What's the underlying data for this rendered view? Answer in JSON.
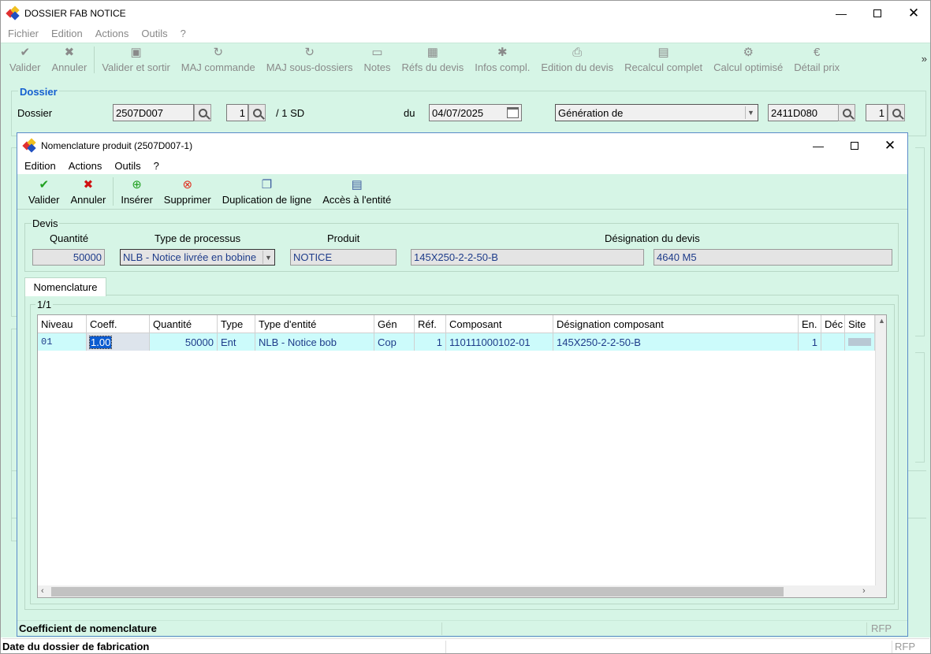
{
  "main": {
    "title": "DOSSIER FAB NOTICE",
    "menu": [
      "Fichier",
      "Edition",
      "Actions",
      "Outils",
      "?"
    ],
    "toolbar": {
      "valider": "Valider",
      "annuler": "Annuler",
      "valider_sortir": "Valider et sortir",
      "maj_commande": "MAJ commande",
      "maj_sous_dossiers": "MAJ sous-dossiers",
      "notes": "Notes",
      "refs_devis": "Réfs du devis",
      "infos": "Infos compl.",
      "edition_devis": "Edition du devis",
      "recalcul": "Recalcul complet",
      "calcul": "Calcul optimisé",
      "detail": "Détail prix",
      "more": "»"
    },
    "dossier_group": "Dossier",
    "dossier_label": "Dossier",
    "dossier_value": "2507D007",
    "sd_value": "1",
    "sd_total": "/ 1 SD",
    "du_label": "du",
    "date_value": "04/07/2025",
    "generation_value": "Génération de",
    "ref_value": "2411D080",
    "ref_num": "1",
    "status_bottom": "Date du dossier de fabrication",
    "status_rfp": "RFP"
  },
  "modal": {
    "title": "Nomenclature produit (2507D007-1)",
    "menu": [
      "Edition",
      "Actions",
      "Outils",
      "?"
    ],
    "toolbar": {
      "valider": "Valider",
      "annuler": "Annuler",
      "inserer": "Insérer",
      "supprimer": "Supprimer",
      "duplication": "Duplication de ligne",
      "acces": "Accès à l'entité"
    },
    "devis_group": "Devis",
    "quantite_label": "Quantité",
    "type_processus_label": "Type de processus",
    "produit_label": "Produit",
    "designation_label": "Désignation du devis",
    "quantite_value": "50000",
    "type_processus_value": "NLB - Notice livrée en bobine",
    "produit_value": "NOTICE",
    "designation_value_1": "145X250-2-2-50-B",
    "designation_value_2": "4640 M5",
    "tab_label": "Nomenclature",
    "page_info": "1/1",
    "columns": [
      "Niveau",
      "Coeff.",
      "Quantité",
      "Type",
      "Type d'entité",
      "Gén",
      "Réf.",
      "Composant",
      "Désignation composant",
      "En.",
      "Déc",
      "Site"
    ],
    "rows": [
      {
        "niveau": "01",
        "coeff": "1.00",
        "quantite": "50000",
        "type": "Ent",
        "type_entite": "NLB - Notice bob",
        "gen": "Cop",
        "ref": "1",
        "composant": "110111000102-01",
        "designation": "145X250-2-2-50-B",
        "en": "1",
        "dec": "",
        "site": ""
      }
    ],
    "status": "Coefficient de nomenclature",
    "status_rfp": "RFP"
  }
}
